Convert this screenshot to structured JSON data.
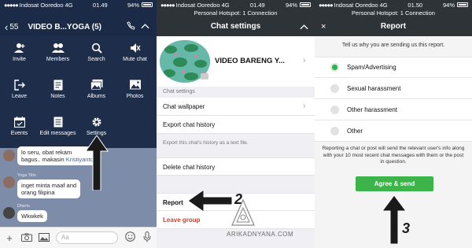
{
  "status1": {
    "carrier": "Indosat Ooredoo",
    "network": "4G",
    "time": "01.49",
    "battery": "94%"
  },
  "status2": {
    "carrier": "Indosat Ooredoo",
    "network": "4G",
    "time": "01.49",
    "battery": "94%",
    "hotspot": "Personal Hotspot: 1 Connection"
  },
  "status3": {
    "carrier": "Indosat Ooredoo",
    "network": "4G",
    "time": "01.50",
    "battery": "94%",
    "hotspot": "Personal Hotspot: 1 Connection"
  },
  "chat": {
    "back_count": "55",
    "title": "VIDEO B...YOGA (5)",
    "menu": [
      "Invite",
      "Members",
      "Search",
      "Mute chat",
      "Leave",
      "Notes",
      "Albums",
      "Photos",
      "Events",
      "Edit messages",
      "Settings"
    ],
    "messages": [
      {
        "text1": "lo seru, obat rekam",
        "text2": "bagus.. makasin",
        "mention": "Kristiyanto"
      },
      {
        "sender": "Yoga Titis",
        "text1": "inget minta maaf and",
        "text2": "orang filipina"
      },
      {
        "sender": "Dheris",
        "text1": "Wkwkek"
      }
    ],
    "input_placeholder": "Aa"
  },
  "settings": {
    "title": "Chat settings",
    "group_name": "VIDEO BARENG Y...",
    "section_label": "Chat settings",
    "rows": [
      "Chat wallpaper",
      "Export chat history"
    ],
    "export_note": "Export this chat's history as a text file.",
    "delete": "Delete chat history",
    "report": "Report",
    "leave": "Leave group"
  },
  "report": {
    "title": "Report",
    "close": "×",
    "prompt": "Tell us why you are sending us this report.",
    "options": [
      "Spam/Advertising",
      "Sexual harassment",
      "Other harassment",
      "Other"
    ],
    "selected": 0,
    "info": "Reporting a chat or post will send the relevant user's info along with your 10 most recent chat messages with them or the post in question.",
    "agree": "Agree & send"
  },
  "steps": [
    "2",
    "3"
  ],
  "watermark": "ARIKADNYANA.COM"
}
